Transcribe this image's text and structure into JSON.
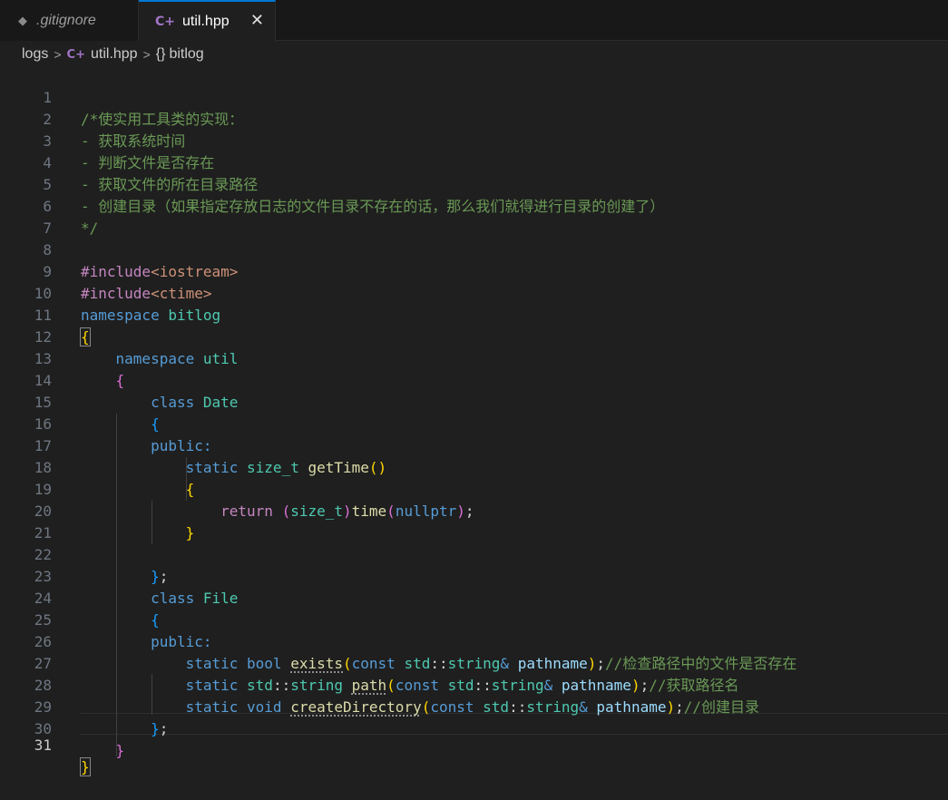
{
  "tabs": [
    {
      "label": ".gitignore",
      "icon": "git-diamond-icon",
      "active": false
    },
    {
      "label": "util.hpp",
      "icon": "cpp-icon",
      "active": true
    }
  ],
  "tab_close": "✕",
  "breadcrumb": {
    "folder": "logs",
    "file": "util.hpp",
    "symbol": "bitlog",
    "braces": "{}"
  },
  "current_line": 31,
  "line_numbers": [
    "1",
    "2",
    "3",
    "4",
    "5",
    "6",
    "7",
    "8",
    "9",
    "10",
    "11",
    "12",
    "13",
    "14",
    "15",
    "16",
    "17",
    "18",
    "19",
    "20",
    "21",
    "22",
    "23",
    "24",
    "25",
    "26",
    "27",
    "28",
    "29",
    "30",
    "31"
  ],
  "code": {
    "l1": "/*使实用工具类的实现：",
    "l2": "- 获取系统时间",
    "l3": "- 判断文件是否存在",
    "l4": "- 获取文件的所在目录路径",
    "l5": "- 创建目录（如果指定存放日志的文件目录不存在的话，那么我们就得进行目录的创建了）",
    "l6": "*/",
    "include1": "#include",
    "include1_hdr": "<iostream>",
    "include2": "#include",
    "include2_hdr": "<ctime>",
    "kw_namespace": "namespace",
    "ns_bitlog": "bitlog",
    "ns_util": "util",
    "kw_class": "class",
    "cls_date": "Date",
    "cls_file": "File",
    "kw_public": "public:",
    "kw_static": "static",
    "ty_size_t": "size_t",
    "fn_gettime": "getTime",
    "kw_return": "return",
    "fn_time": "time",
    "kw_nullptr": "nullptr",
    "kw_bool": "bool",
    "fn_exists": "exists",
    "kw_const": "const",
    "std": "std",
    "ty_string": "string",
    "pa_pathname": "pathname",
    "fn_path": "path",
    "kw_void": "void",
    "fn_createdir": "createDirectory",
    "cm_exists": "//检查路径中的文件是否存在",
    "cm_path": "//获取路径名",
    "cm_create": "//创建目录"
  }
}
